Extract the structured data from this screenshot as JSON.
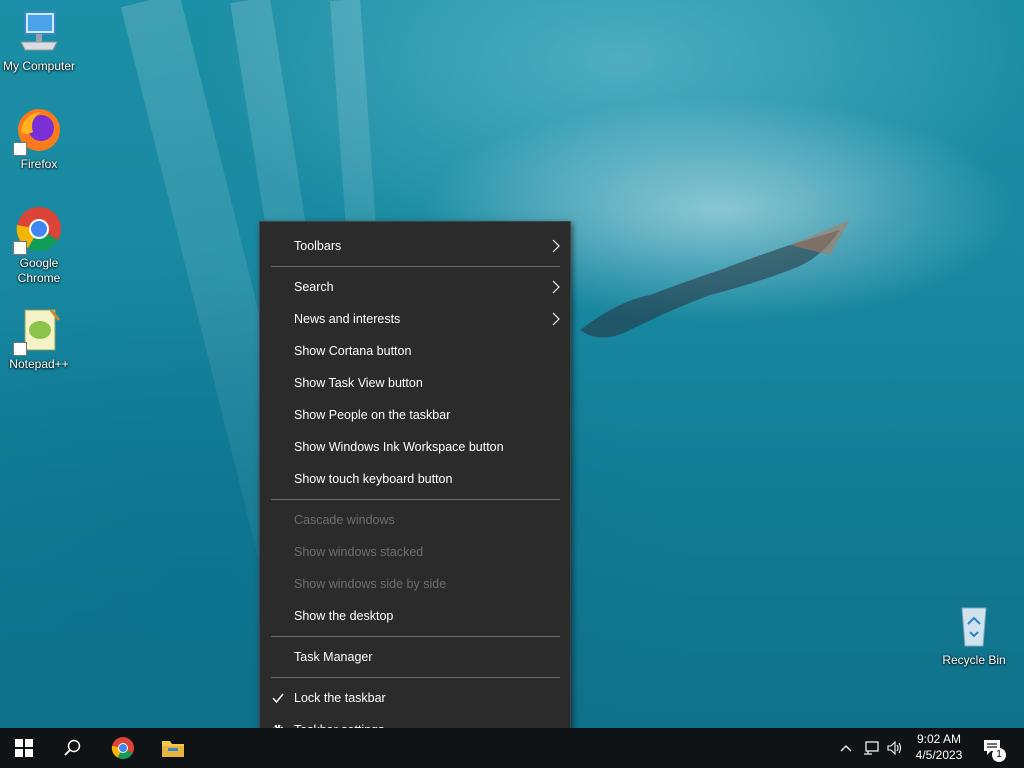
{
  "desktop": {
    "icons": [
      {
        "label": "My Computer"
      },
      {
        "label": "Firefox"
      },
      {
        "label": "Google Chrome"
      },
      {
        "label": "Notepad++"
      },
      {
        "label": "Recycle Bin"
      }
    ]
  },
  "context_menu": {
    "items": [
      {
        "label": "Toolbars",
        "submenu": true,
        "enabled": true
      },
      {
        "label": "Search",
        "submenu": true,
        "enabled": true
      },
      {
        "label": "News and interests",
        "submenu": true,
        "enabled": true
      },
      {
        "label": "Show Cortana button",
        "enabled": true
      },
      {
        "label": "Show Task View button",
        "enabled": true
      },
      {
        "label": "Show People on the taskbar",
        "enabled": true
      },
      {
        "label": "Show Windows Ink Workspace button",
        "enabled": true
      },
      {
        "label": "Show touch keyboard button",
        "enabled": true
      },
      {
        "label": "Cascade windows",
        "enabled": false
      },
      {
        "label": "Show windows stacked",
        "enabled": false
      },
      {
        "label": "Show windows side by side",
        "enabled": false
      },
      {
        "label": "Show the desktop",
        "enabled": true
      },
      {
        "label": "Task Manager",
        "enabled": true
      },
      {
        "label": "Lock the taskbar",
        "enabled": true,
        "checked": true
      },
      {
        "label": "Taskbar settings",
        "enabled": true,
        "icon": "gear-icon"
      }
    ]
  },
  "taskbar": {
    "pinned": [
      "start-icon",
      "search-icon",
      "chrome-icon",
      "file-explorer-icon"
    ],
    "tray": {
      "time": "9:02 AM",
      "date": "4/5/2023",
      "notification_count": "1"
    }
  },
  "colors": {
    "menu_bg": "#2b2b2b",
    "taskbar_bg": "#101315",
    "disabled_text": "#6d6d6d"
  }
}
